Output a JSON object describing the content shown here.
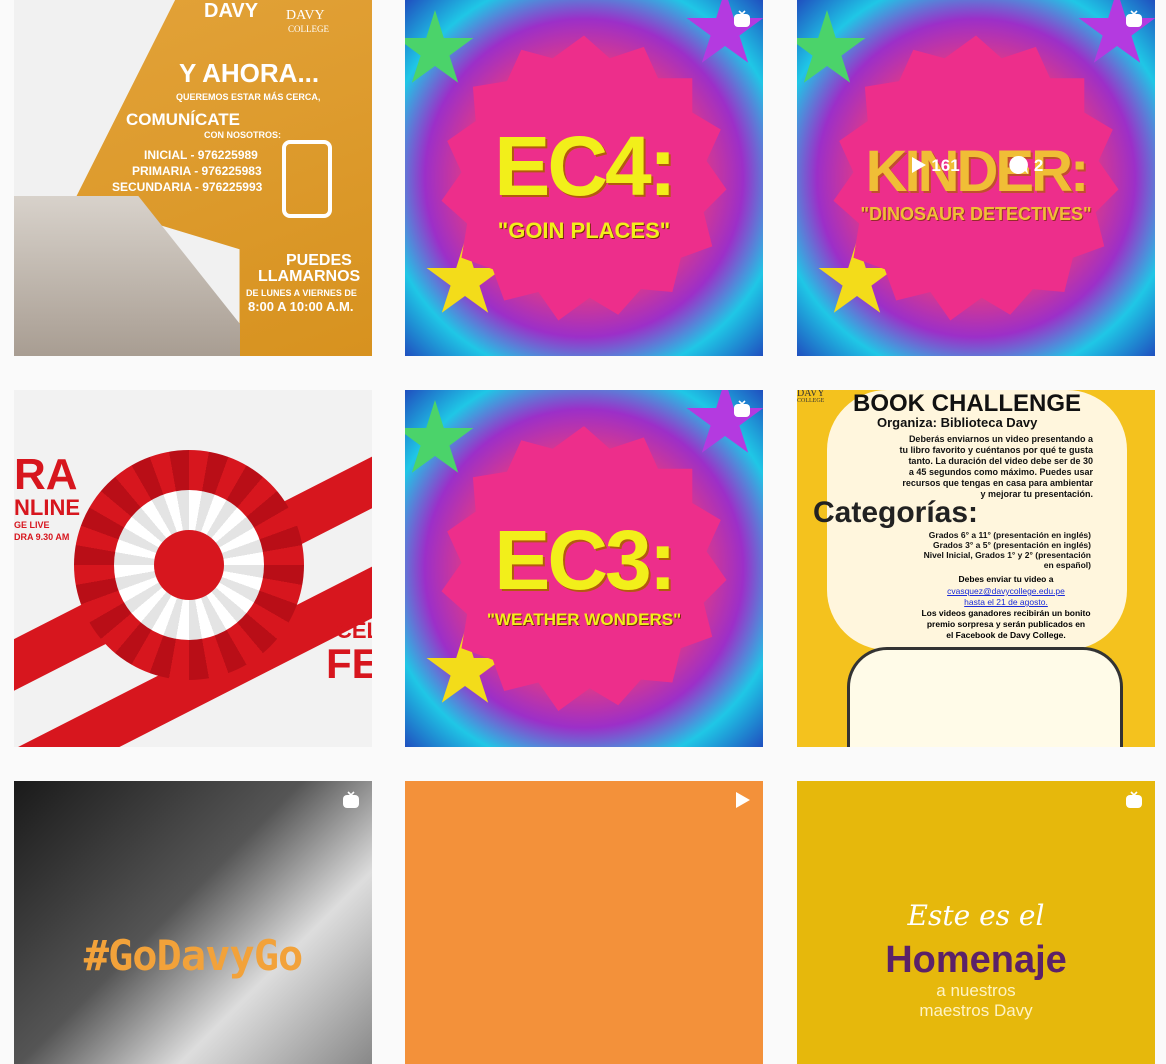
{
  "posts": [
    {
      "davy": "DAVY",
      "college_top": "DAVY",
      "college_bottom": "COLLEGE",
      "headline": "Y AHORA...",
      "subline": "QUEREMOS ESTAR MÁS CERCA,",
      "comunicate": "COMUNÍCATE",
      "con": "CON NOSOTROS:",
      "inicial": "INICIAL - 976225989",
      "primaria": "PRIMARIA - 976225983",
      "secundaria": "SECUNDARIA - 976225993",
      "puedes": "PUEDES",
      "llamarnos": "LLAMARNOS",
      "dias": "DE LUNES A VIERNES DE",
      "horario": "8:00 A 10:00 A.M."
    },
    {
      "title": "EC4:",
      "subtitle": "\"GOIN PLACES\"",
      "badge": "igtv-icon"
    },
    {
      "title": "KINDER:",
      "subtitle": "\"DINOSAUR DETECTIVES\"",
      "plays": "161",
      "comments": "2",
      "badge": "igtv-icon"
    },
    {
      "ra": "RA",
      "online": "NLINE",
      "live": "GE LIVE",
      "hora": "DRA 9.30 AM",
      "cel": "CEL",
      "fe": "FE"
    },
    {
      "title": "EC3:",
      "subtitle": "\"WEATHER WONDERS\"",
      "badge": "igtv-icon"
    },
    {
      "davy_small": "DAVY",
      "college_small": "COLLEGE",
      "title": "BOOK CHALLENGE",
      "organiza": "Organiza: Biblioteca Davy",
      "body1": "Deberás enviarnos  un video  presentando a",
      "body2": "tu libro favorito y cuéntanos por qué te gusta",
      "body3": "tanto. La duración del video debe ser de 30",
      "body4": "a 45 segundos como máximo. Puedes usar",
      "body5": "recursos que tengas en casa para ambientar",
      "body6": "y mejorar tu presentación.",
      "categorias": "Categorías:",
      "cat1": "Grados 6° a 11° (presentación en inglés)",
      "cat2": "Grados 3° a 5°  (presentación en inglés)",
      "cat3": "Nivel Inicial, Grados 1° y 2°  (presentación",
      "cat4": "en español)",
      "enviar": "Debes enviar tu video a",
      "email": "cvasquez@davycollege.edu.pe",
      "hasta": "hasta el 21 de agosto.",
      "gan1": "Los videos ganadores recibirán un bonito",
      "gan2": "premio sorpresa y serán publicados en",
      "gan3": "el Facebook  de Davy College."
    },
    {
      "hashtag": "#GoDavyGo",
      "badge": "igtv-icon"
    },
    {
      "badge": "video-play-icon"
    },
    {
      "line1": "Este es el",
      "line2": "Homenaje",
      "line3": "a nuestros",
      "line4": "maestros Davy",
      "badge": "igtv-icon"
    }
  ],
  "colors": {
    "gold": "#d7921f",
    "pink": "#ed2e8b",
    "yellow": "#f2ef1a",
    "red": "#d7161e",
    "orange": "#f3913a",
    "mustard": "#e6b80c",
    "purple": "#5b2168"
  }
}
